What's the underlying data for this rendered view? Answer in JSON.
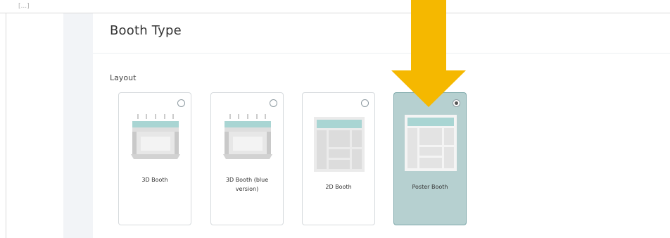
{
  "page": {
    "rail_text": "[...]",
    "title": "Booth Type",
    "section_label": "Layout"
  },
  "cards": [
    {
      "label": "3D Booth",
      "selected": false,
      "icon": "3d-booth-icon"
    },
    {
      "label": "3D Booth (blue version)",
      "selected": false,
      "icon": "3d-booth-icon"
    },
    {
      "label": "2D Booth",
      "selected": false,
      "icon": "2d-booth-icon"
    },
    {
      "label": "Poster Booth",
      "selected": true,
      "icon": "poster-booth-icon"
    }
  ],
  "annotation": {
    "icon": "arrow-down-icon",
    "color": "#F5B800"
  },
  "colors": {
    "selected_card": "#B6D0D0",
    "accent_teal": "#A9D5D3"
  }
}
